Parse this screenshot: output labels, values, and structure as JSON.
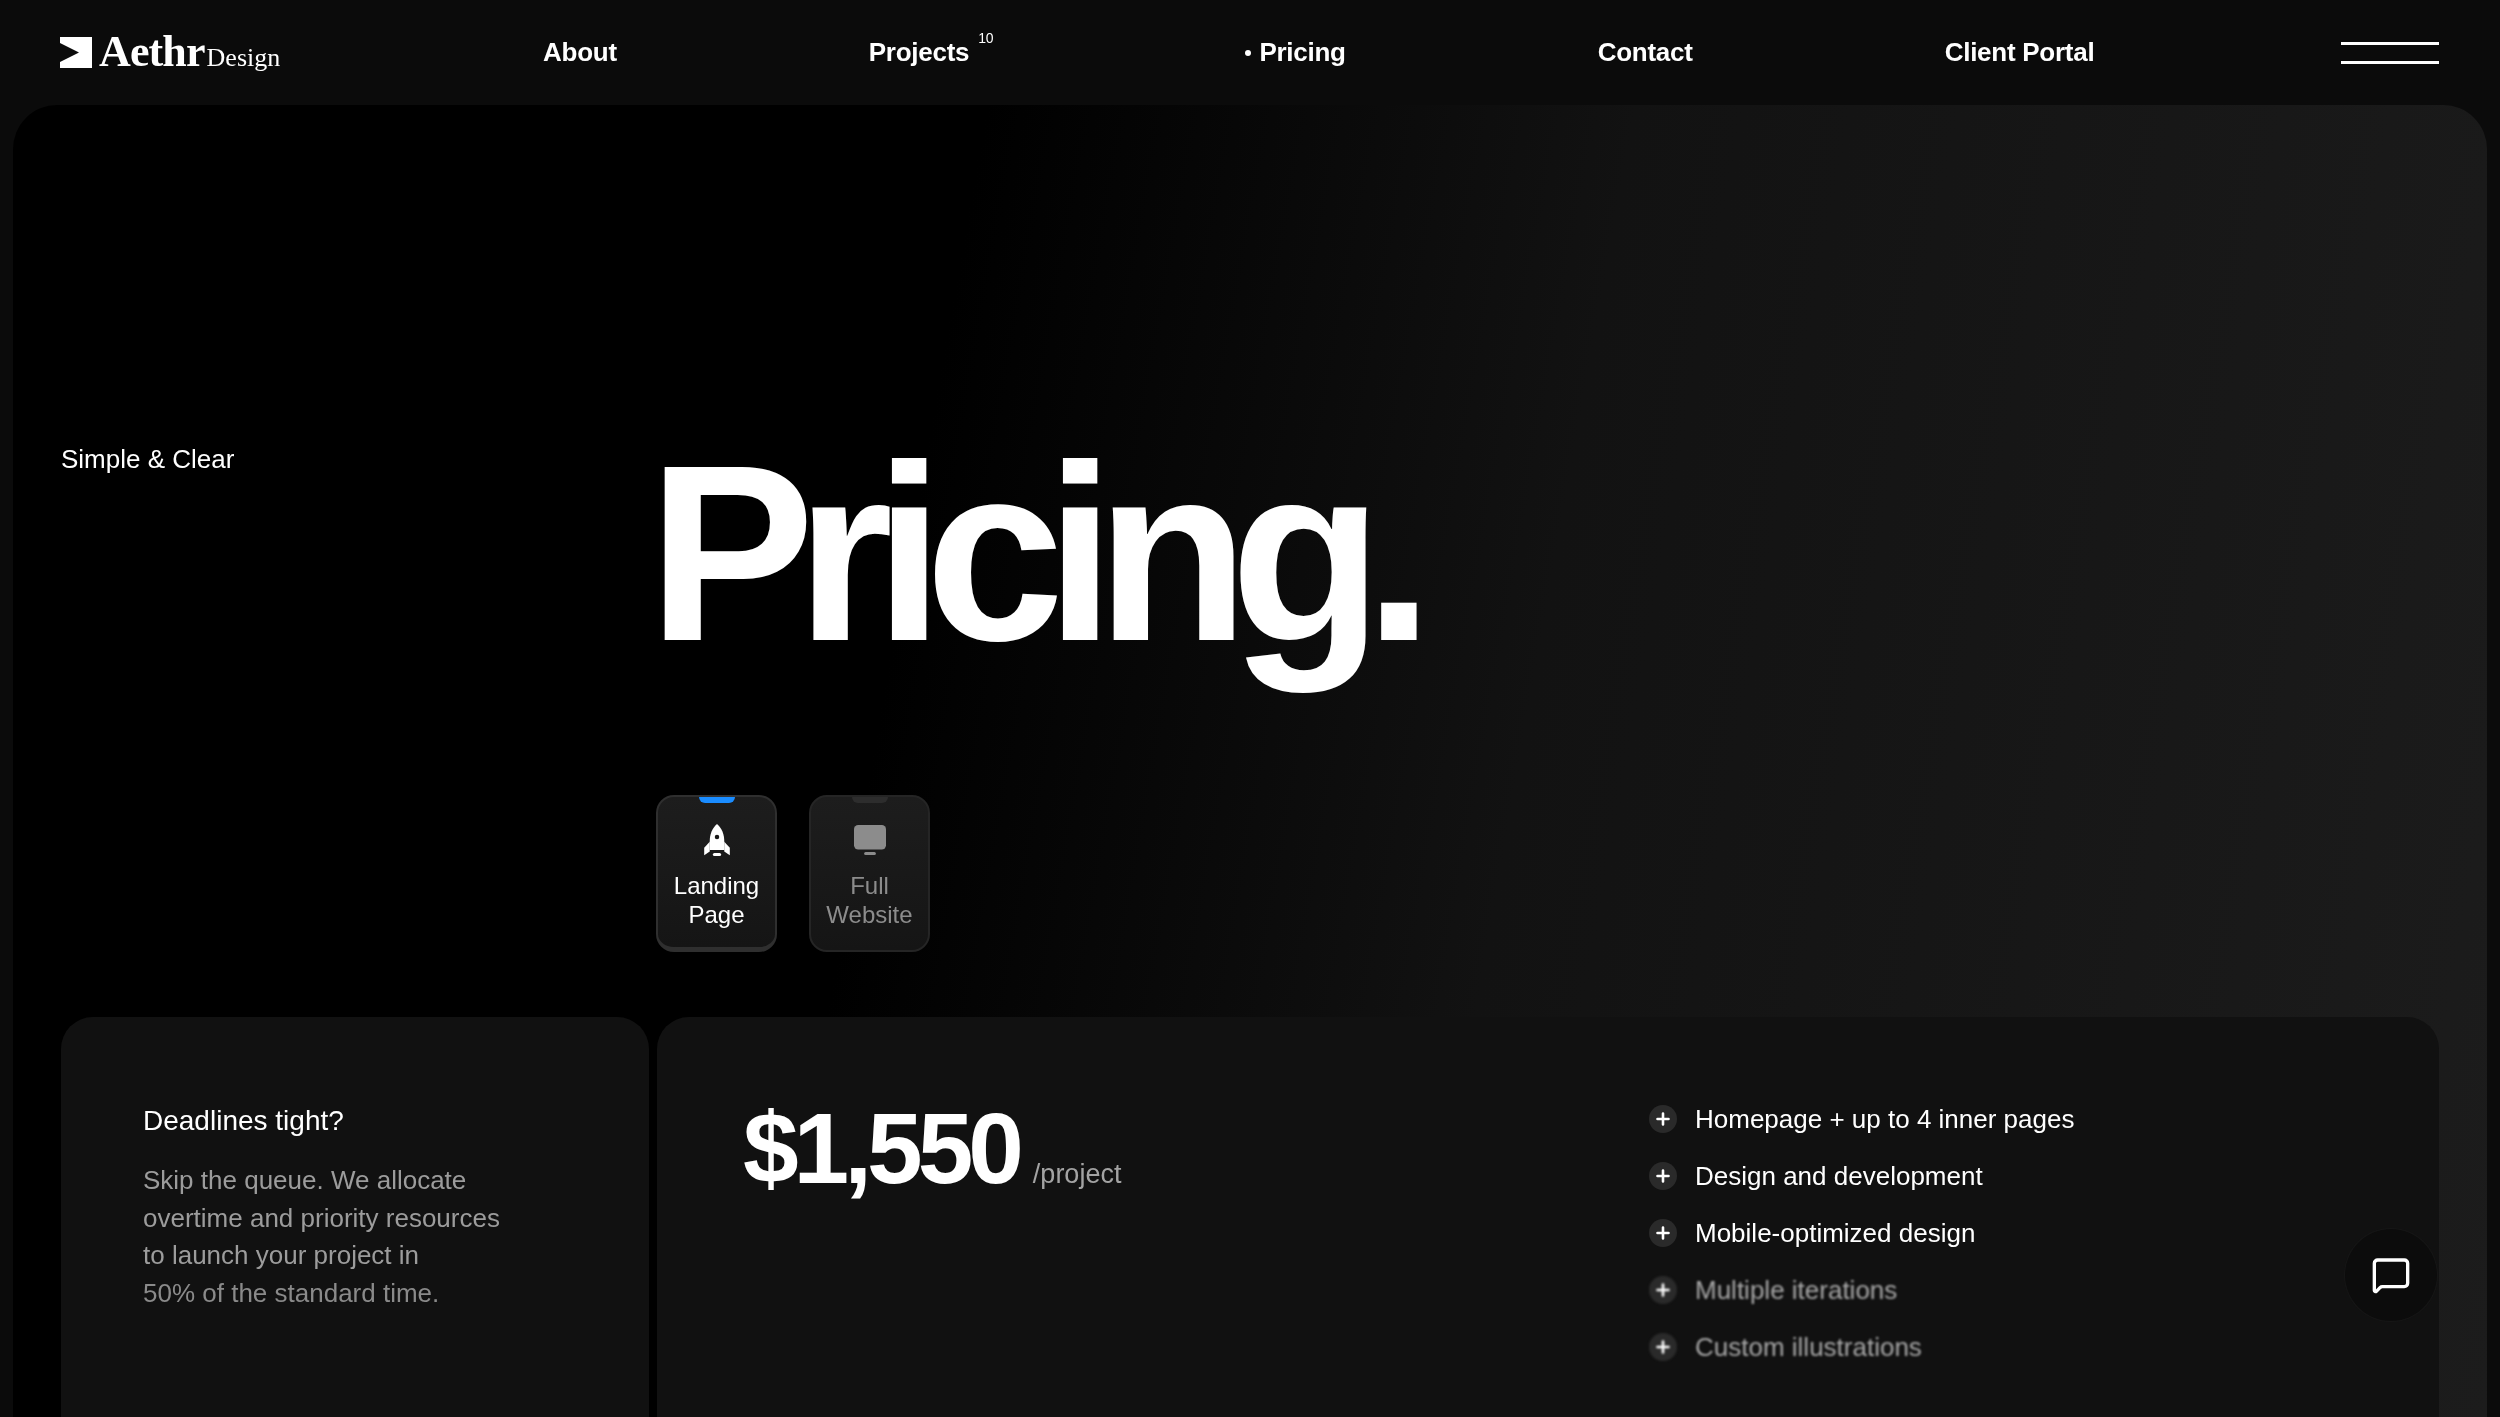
{
  "logo": {
    "name": "Aethr",
    "suffix": "Design"
  },
  "nav": {
    "items": [
      {
        "label": "About",
        "selected": false
      },
      {
        "label": "Projects",
        "count": "10",
        "selected": false
      },
      {
        "label": "Pricing",
        "selected": true
      },
      {
        "label": "Contact",
        "selected": false
      },
      {
        "label": "Client Portal",
        "selected": false
      }
    ]
  },
  "hero": {
    "eyebrow": "Simple & Clear",
    "title": "Pricing."
  },
  "plan_tabs": [
    {
      "label": "Landing Page",
      "selected": true
    },
    {
      "label": "Full Website",
      "selected": false
    }
  ],
  "deadline_card": {
    "title": "Deadlines tight?",
    "body": "Skip the queue. We allocate overtime and priority resources to launch your project in",
    "body_tail": "50% of the standard time."
  },
  "price_card": {
    "amount": "$1,550",
    "unit": "/project",
    "features": [
      {
        "text": "Homepage + up to 4 inner pages",
        "dimmed": false
      },
      {
        "text": "Design and development",
        "dimmed": false
      },
      {
        "text": "Mobile-optimized design",
        "dimmed": false
      },
      {
        "text": "Multiple iterations",
        "dimmed": true
      },
      {
        "text": "Custom illustrations",
        "dimmed": true
      }
    ]
  }
}
